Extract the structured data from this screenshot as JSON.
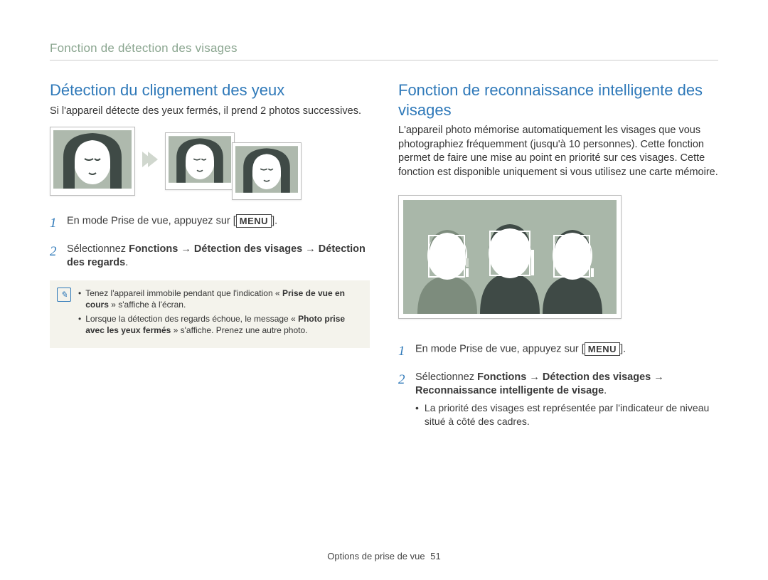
{
  "section_label": "Fonction de détection des visages",
  "left": {
    "title": "Détection du clignement des yeux",
    "intro": "Si l'appareil détecte des yeux fermés, il prend 2 photos successives.",
    "step1_prefix": "En mode Prise de vue, appuyez sur [",
    "step1_suffix": "].",
    "menu_label": "MENU",
    "step2_html": "Sélectionnez <b>Fonctions</b> → <b>Détection des visages</b> → <b>Détection des regards</b>.",
    "info1": "Tenez l'appareil immobile pendant que l'indication « <b>Prise de vue en cours</b> » s'affiche à l'écran.",
    "info2": "Lorsque la détection des regards échoue, le message « <b>Photo prise avec les yeux fermés</b> » s'affiche. Prenez une autre photo."
  },
  "right": {
    "title": "Fonction de reconnaissance intelligente des visages",
    "intro": "L'appareil photo mémorise automatiquement les visages que vous photographiez fréquemment (jusqu'à 10 personnes). Cette fonction permet de faire une mise au point en priorité sur ces visages. Cette fonction est disponible uniquement si vous utilisez une carte mémoire.",
    "step1_prefix": "En mode Prise de vue, appuyez sur [",
    "step1_suffix": "].",
    "menu_label": "MENU",
    "step2_html": "Sélectionnez <b>Fonctions</b> → <b>Détection des visages</b> → <b>Reconnaissance intelligente de visage</b>.",
    "sub_bullet": "La priorité des visages est représentée par l'indicateur de niveau situé à côté des cadres."
  },
  "footer": {
    "text": "Options de prise de vue",
    "page": "51"
  },
  "icons": {
    "arrow": "arrow-right-icon",
    "info": "info-icon"
  }
}
